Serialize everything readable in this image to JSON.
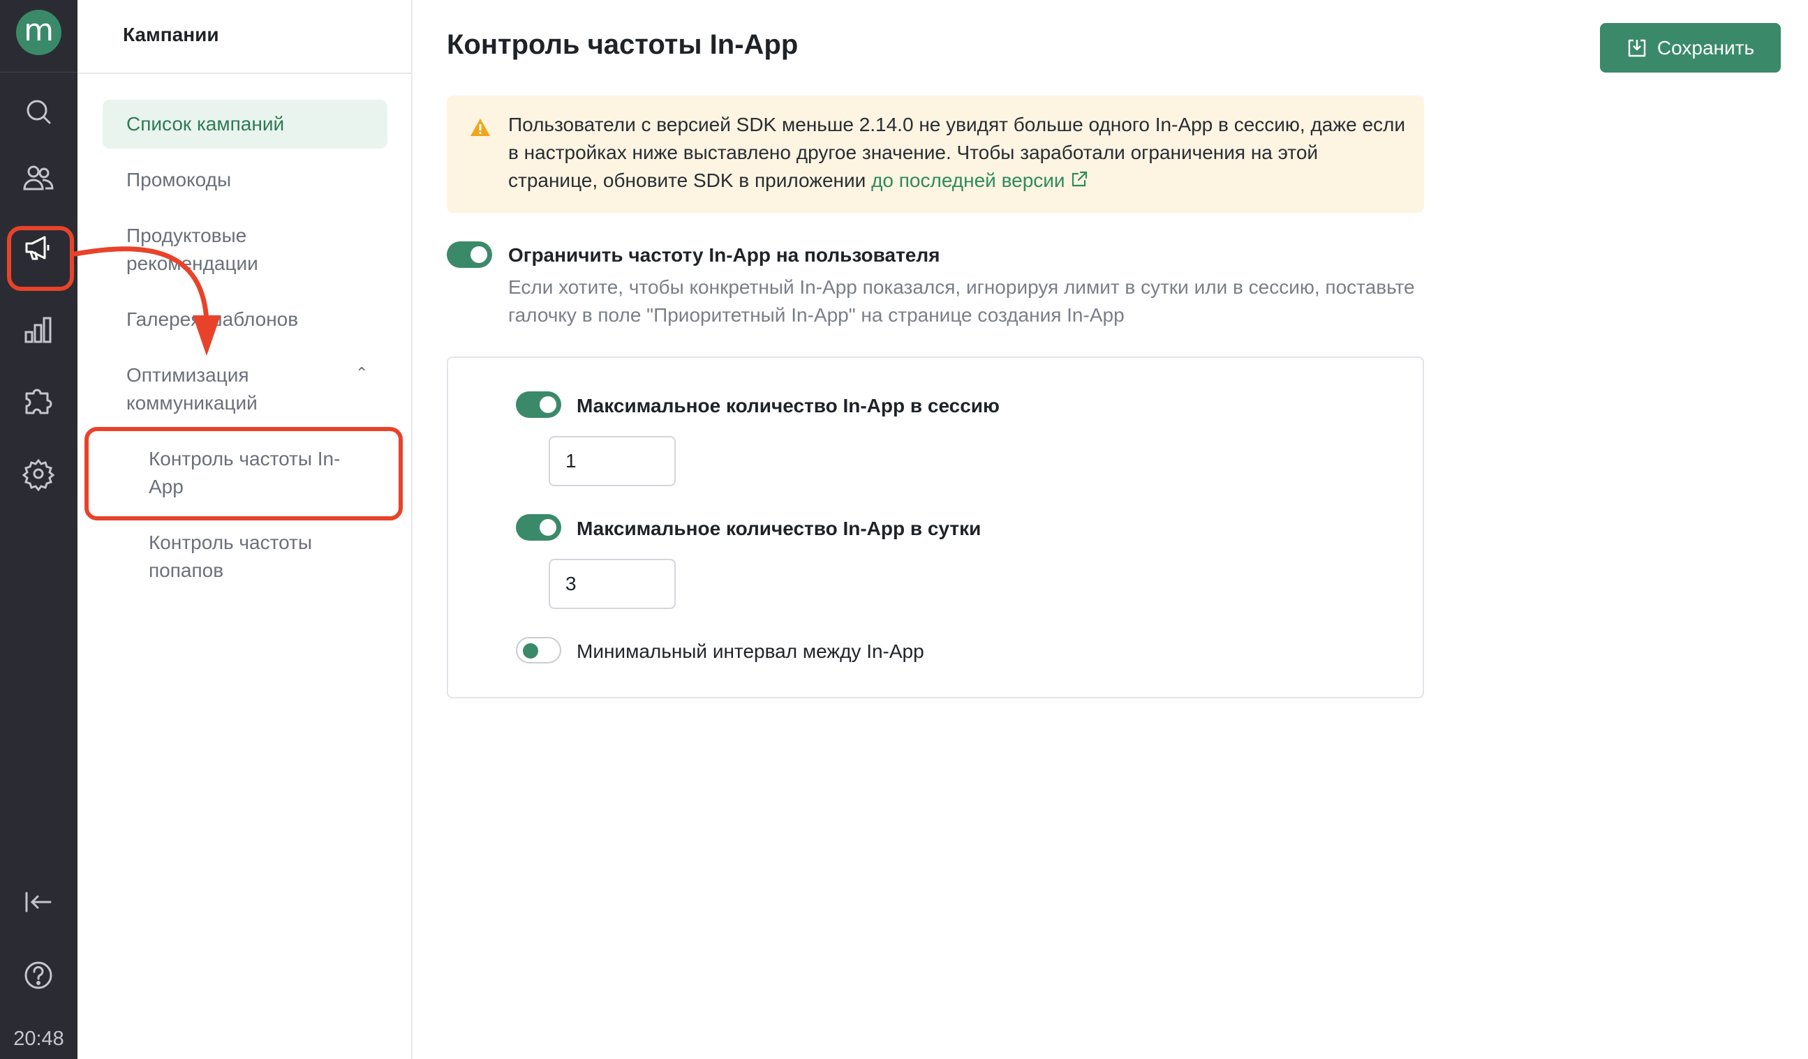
{
  "rail": {
    "logo": "m",
    "time": "20:48",
    "icons": [
      "search-icon",
      "users-icon",
      "megaphone-icon",
      "chart-icon",
      "puzzle-icon",
      "gear-icon",
      "collapse-icon",
      "help-icon"
    ],
    "highlight_color": "#e8432a"
  },
  "subnav": {
    "title": "Кампании",
    "items": [
      {
        "label": "Список кампаний"
      },
      {
        "label": "Промокоды"
      },
      {
        "label": "Продуктовые рекомендации"
      },
      {
        "label": "Галерея шаблонов"
      },
      {
        "label": "Оптимизация коммуникаций"
      },
      {
        "label": "Контроль частоты In-App"
      },
      {
        "label": "Контроль частоты попапов"
      }
    ]
  },
  "main": {
    "title": "Контроль частоты In-App",
    "save_label": "Сохранить",
    "alert": {
      "text": "Пользователи с версией SDK меньше 2.14.0 не увидят больше одного In-App в сессию, даже если в настройках ниже выставлено другое значение. Чтобы заработали ограничения на этой странице, обновите SDK в приложении ",
      "link": "до последней версии"
    },
    "limit_toggle": {
      "label": "Ограничить частоту In-App на пользователя",
      "description": "Если хотите, чтобы конкретный In-App показался, игнорируя лимит в сутки или в сессию, поставьте галочку в поле \"Приоритетный In-App\" на странице создания In-App"
    },
    "options": [
      {
        "label": "Максимальное количество In-App в сессию",
        "value": "1"
      },
      {
        "label": "Максимальное количество In-App в сутки",
        "value": "3"
      },
      {
        "label": "Минимальный интервал между In-App"
      }
    ]
  },
  "colors": {
    "accent": "#3a8a6a",
    "rail_bg": "#2b2c33",
    "alert_bg": "#fdf4e2",
    "link": "#2f8a5c"
  }
}
